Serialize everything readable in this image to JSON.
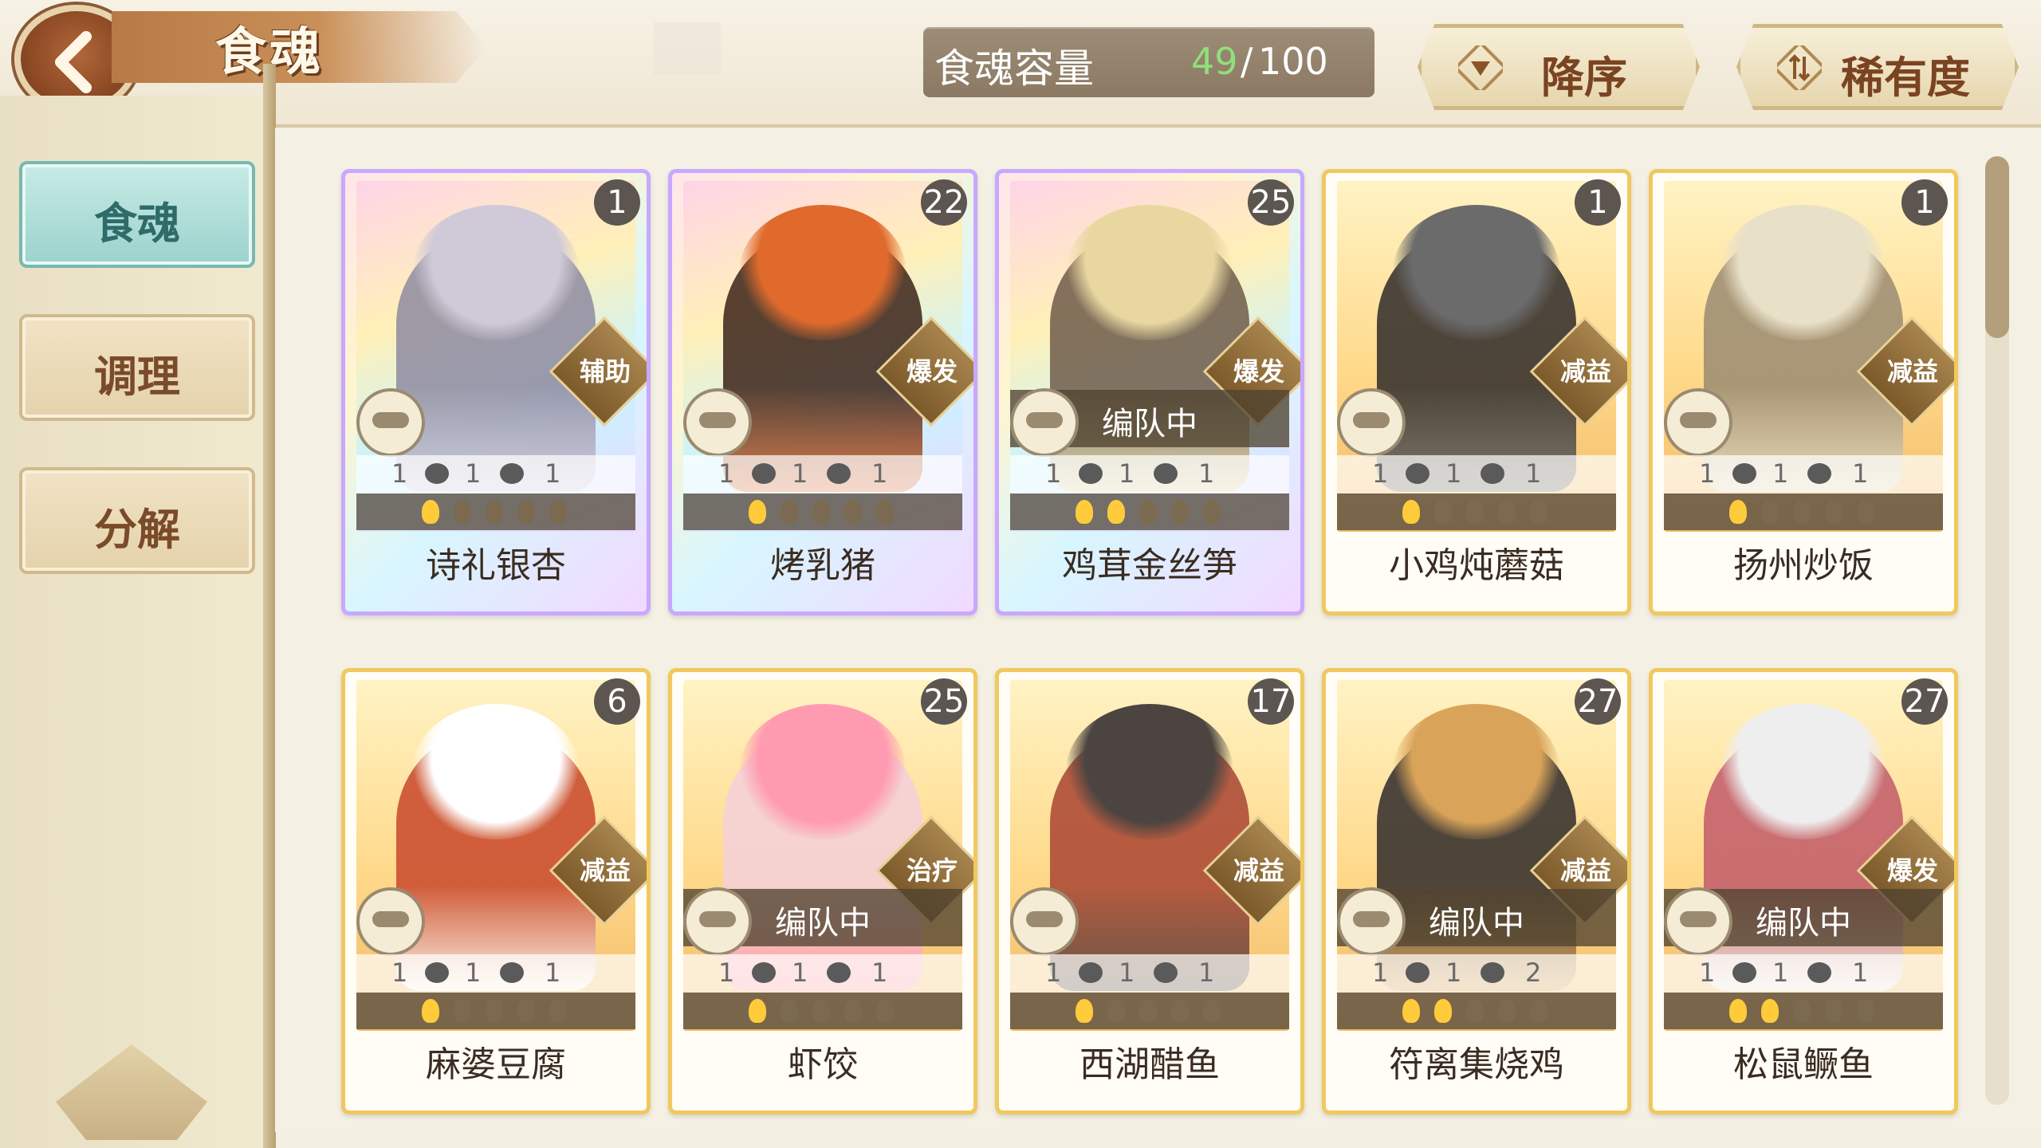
{
  "header": {
    "title": "食魂",
    "capacity_label": "食魂容量",
    "capacity_current": "49",
    "capacity_max": "100",
    "capacity_separator": "/",
    "sort_order_label": "降序",
    "sort_field_label": "稀有度"
  },
  "sidebar": {
    "items": [
      {
        "label": "食魂",
        "active": true
      },
      {
        "label": "调理",
        "active": false
      },
      {
        "label": "分解",
        "active": false
      }
    ]
  },
  "colors": {
    "accent_teal": "#9cd2cc",
    "capacity_green": "#8fe07b",
    "gold_border": "#f0c95e",
    "brown_text": "#7a4322"
  },
  "cards": [
    {
      "name": "诗礼银杏",
      "level": "1",
      "role": "辅助",
      "in_team": false,
      "team_label": "",
      "rare": true,
      "skills": [
        "1",
        "1",
        "1"
      ],
      "stars": 1
    },
    {
      "name": "烤乳猪",
      "level": "22",
      "role": "爆发",
      "in_team": false,
      "team_label": "",
      "rare": true,
      "skills": [
        "1",
        "1",
        "1"
      ],
      "stars": 1
    },
    {
      "name": "鸡茸金丝笋",
      "level": "25",
      "role": "爆发",
      "in_team": true,
      "team_label": "编队中",
      "rare": true,
      "skills": [
        "1",
        "1",
        "1"
      ],
      "stars": 2
    },
    {
      "name": "小鸡炖蘑菇",
      "level": "1",
      "role": "减益",
      "in_team": false,
      "team_label": "",
      "rare": false,
      "skills": [
        "1",
        "1",
        "1"
      ],
      "stars": 1
    },
    {
      "name": "扬州炒饭",
      "level": "1",
      "role": "减益",
      "in_team": false,
      "team_label": "",
      "rare": false,
      "skills": [
        "1",
        "1",
        "1"
      ],
      "stars": 1
    },
    {
      "name": "麻婆豆腐",
      "level": "6",
      "role": "减益",
      "in_team": false,
      "team_label": "",
      "rare": false,
      "skills": [
        "1",
        "1",
        "1"
      ],
      "stars": 1
    },
    {
      "name": "虾饺",
      "level": "25",
      "role": "治疗",
      "in_team": true,
      "team_label": "编队中",
      "rare": false,
      "skills": [
        "1",
        "1",
        "1"
      ],
      "stars": 1
    },
    {
      "name": "西湖醋鱼",
      "level": "17",
      "role": "减益",
      "in_team": false,
      "team_label": "",
      "rare": false,
      "skills": [
        "1",
        "1",
        "1"
      ],
      "stars": 1
    },
    {
      "name": "符离集烧鸡",
      "level": "27",
      "role": "减益",
      "in_team": true,
      "team_label": "编队中",
      "rare": false,
      "skills": [
        "1",
        "1",
        "2"
      ],
      "stars": 2
    },
    {
      "name": "松鼠鳜鱼",
      "level": "27",
      "role": "爆发",
      "in_team": true,
      "team_label": "编队中",
      "rare": false,
      "skills": [
        "1",
        "1",
        "1"
      ],
      "stars": 2
    }
  ]
}
